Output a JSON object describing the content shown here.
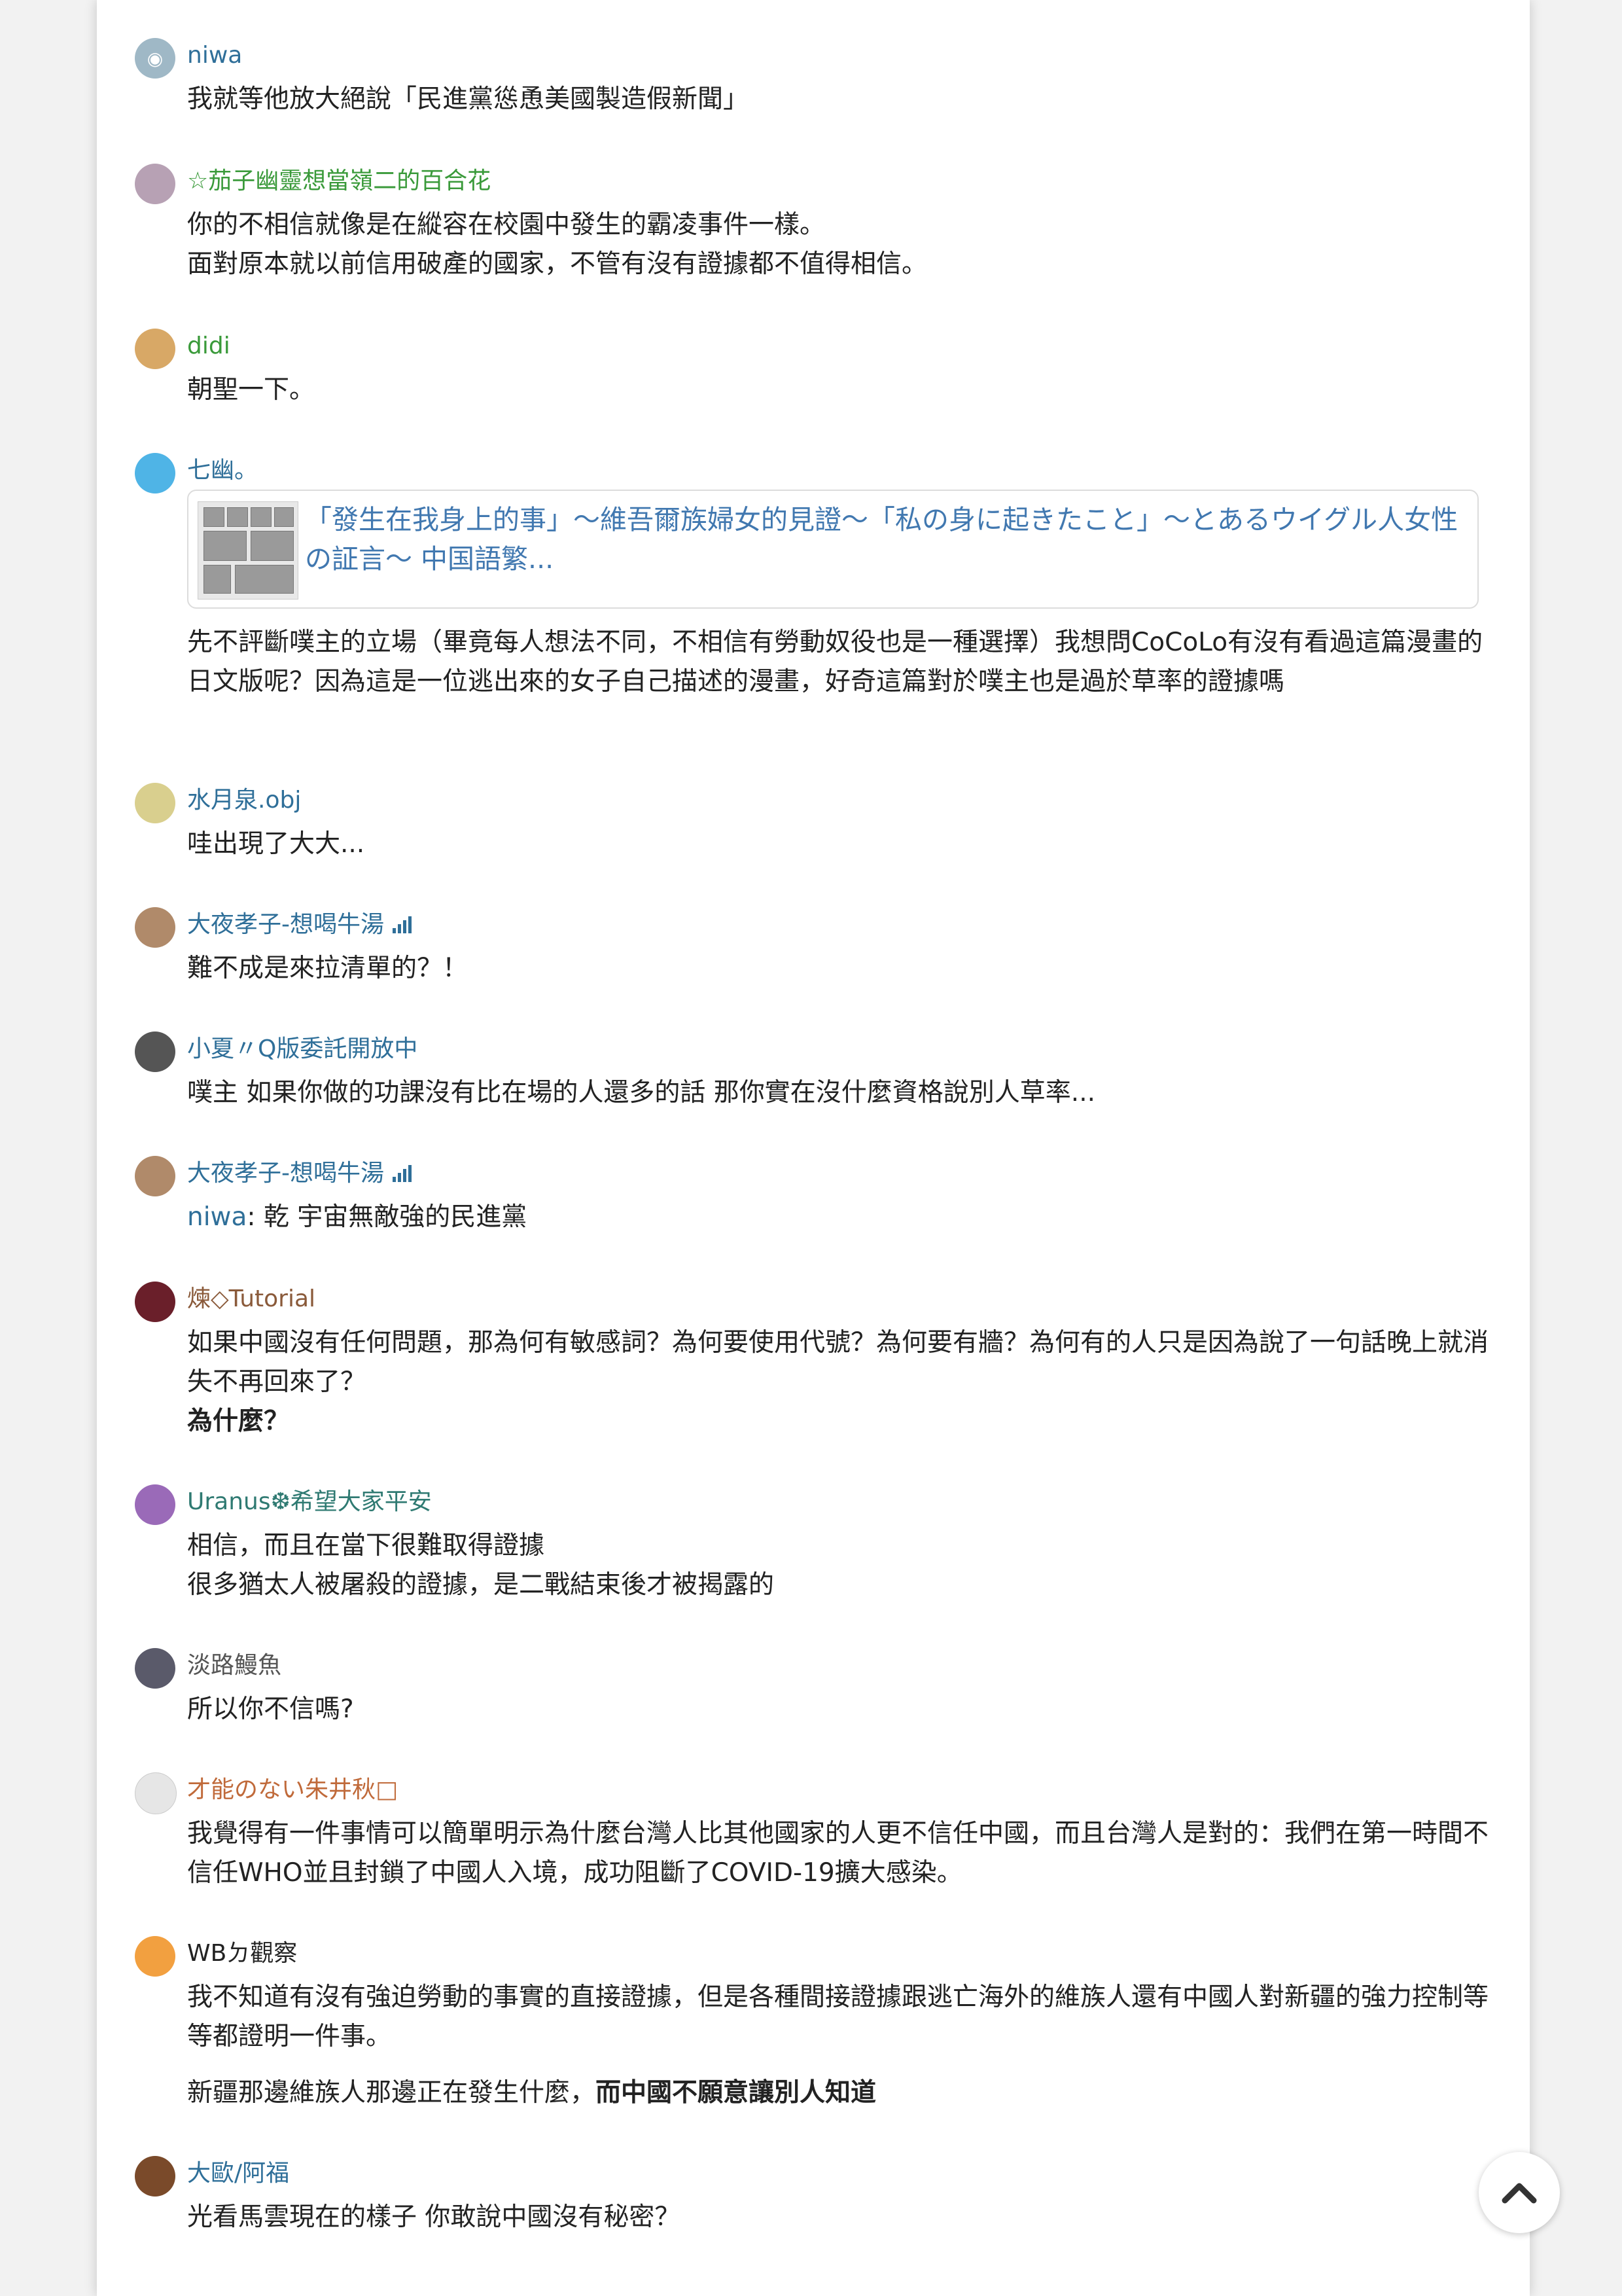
{
  "comments": [
    {
      "name": "niwa",
      "name_color": "#2f6f99",
      "avatar_bg": "#9fb8c6",
      "lines": [
        "我就等他放大絕說「民進黨慫恿美國製造假新聞」"
      ]
    },
    {
      "name": "☆茄子幽靈想當嶺二的百合花",
      "name_color": "#3a9a3a",
      "avatar_bg": "#b7a1b4",
      "lines": [
        "你的不相信就像是在縱容在校園中發生的霸凌事件一樣。",
        "面對原本就以前信用破產的國家，不管有沒有證據都不值得相信。"
      ]
    },
    {
      "name": "didi",
      "name_color": "#3a9a3a",
      "avatar_bg": "#d8a866",
      "lines": [
        "朝聖一下。"
      ]
    },
    {
      "name": "七幽。",
      "name_color": "#2f6f99",
      "avatar_bg": "#4fb4e6",
      "link_title": "「發生在我身上的事」～維吾爾族婦女的見證～「私の身に起きたこと」～とあるウイグル人女性の証言～ 中国語繁...",
      "lines": [
        "先不評斷噗主的立場（畢竟每人想法不同，不相信有勞動奴役也是一種選擇）我想問CoCoLo有沒有看過這篇漫畫的日文版呢？因為這是一位逃出來的女子自己描述的漫畫，好奇這篇對於噗主也是過於草率的證據嗎"
      ]
    },
    {
      "name": "水月泉.obj",
      "name_color": "#2f6f99",
      "avatar_bg": "#d9cf8e",
      "lines": [
        "哇出現了大大..."
      ]
    },
    {
      "name": "大夜孝子-想喝牛湯",
      "name_color": "#2f6f99",
      "avatar_bg": "#b08a6a",
      "lines": [
        "難不成是來拉清單的？！"
      ]
    },
    {
      "name": "小夏〃Q版委託開放中",
      "name_color": "#2f6f99",
      "avatar_bg": "#555555",
      "lines": [
        "噗主 如果你做的功課沒有比在場的人還多的話 那你實在沒什麼資格說別人草率..."
      ]
    },
    {
      "name": "大夜孝子-想喝牛湯",
      "name_color": "#2f6f99",
      "avatar_bg": "#b08a6a",
      "mention": "niwa",
      "lines": [
        ": 乾 宇宙無敵強的民進黨"
      ]
    },
    {
      "name": "煉◇Tutorial",
      "name_color": "#8a5a3a",
      "avatar_bg": "#6a1f2a",
      "lines": [
        "如果中國沒有任何問題，那為何有敏感詞？為何要使用代號？為何要有牆？為何有的人只是因為說了一句話晚上就消失不再回來了？"
      ],
      "bold_line": "為什麼？"
    },
    {
      "name": "Uranus❆希望大家平安",
      "name_color": "#2f7a72",
      "avatar_bg": "#9a6ab8",
      "lines": [
        "相信，而且在當下很難取得證據",
        "很多猶太人被屠殺的證據，是二戰結束後才被揭露的"
      ]
    },
    {
      "name": "淡路鰻魚",
      "name_color": "#555555",
      "avatar_bg": "#5a5a6a",
      "lines": [
        "所以你不信嗎?"
      ]
    },
    {
      "name": "才能のない朱井秋□",
      "name_color": "#c06a3a",
      "avatar_bg": "#e6e6e6",
      "lines": [
        "我覺得有一件事情可以簡單明示為什麼台灣人比其他國家的人更不信任中國，而且台灣人是對的：我們在第一時間不信任WHO並且封鎖了中國人入境，成功阻斷了COVID-19擴大感染。"
      ]
    },
    {
      "name": "WBㄉ觀察",
      "name_color": "#222222",
      "avatar_bg": "#f2a040",
      "lines": [
        "我不知道有沒有強迫勞動的事實的直接證據，但是各種間接證據跟逃亡海外的維族人還有中國人對新疆的強力控制等等都證明一件事。"
      ],
      "extra_plain": "新疆那邊維族人那邊正在發生什麼，",
      "extra_bold": "而中國不願意讓別人知道"
    },
    {
      "name": "大歐/阿福",
      "name_color": "#2f6f99",
      "avatar_bg": "#7a4a2a",
      "lines": [
        "光看馬雲現在的樣子 你敢說中國沒有秘密？"
      ]
    }
  ],
  "scroll_top": {
    "icon": "chevron-up-icon"
  }
}
